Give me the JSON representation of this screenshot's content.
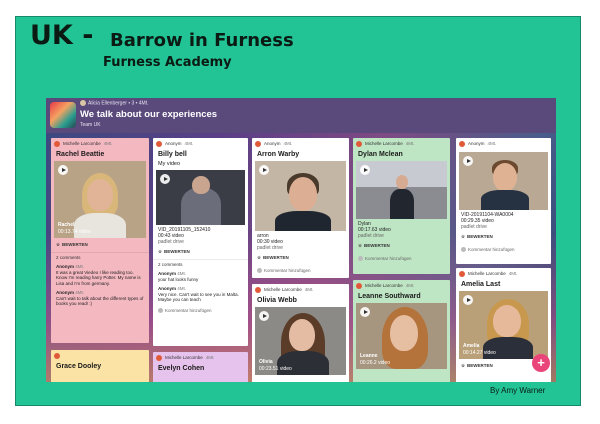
{
  "heading": {
    "country": "UK -",
    "city": "Barrow in Furness",
    "school": "Furness Academy"
  },
  "author": "By Amy Warner",
  "board": {
    "owner": "Alicia Ellenberger",
    "owner_meta": "• 3 • 4Mt.",
    "title": "We talk about our experiences",
    "subtitle": "Team UK"
  },
  "labels": {
    "react": "BEWERTEN",
    "add_comment": "Kommentar hinzufügen",
    "source": "padlet drive"
  },
  "cards": {
    "c1": {
      "author": "Michelle Larcombe",
      "time": "4Mt.",
      "title": "Rachel Beattie",
      "video_name": "Rachel",
      "duration": "00:13.74 video",
      "comments_count": "2 comments",
      "comments": [
        {
          "author": "Anonym",
          "time": "4Mt.",
          "text": "It was a great Viedeo I like reading too. Know I'm reading harry Potter. My name is Lisa and I'm from germany."
        },
        {
          "author": "Anonym",
          "time": "4Mt.",
          "text": "Can't wait to talk about the different types of books you read! :)"
        }
      ]
    },
    "c1b": {
      "title": "Grace Dooley"
    },
    "c2": {
      "author": "Anonym",
      "time": "4Mt.",
      "title": "Billy bell",
      "body": "My video",
      "file": "VID_20191105_152410",
      "duration": "00:43 video",
      "comments_count": "2 comments",
      "comments": [
        {
          "author": "Anonym",
          "time": "4Mt.",
          "text": "your hat looks funny"
        },
        {
          "author": "Anonym",
          "time": "4Mt.",
          "text": "Very nice. Can't wait to see you in Malta. Maybe you can teach"
        }
      ]
    },
    "c2b": {
      "author": "Michelle Larcombe",
      "time": "4Mt.",
      "title": "Evelyn Cohen"
    },
    "c3": {
      "author": "Anonym",
      "time": "4Mt.",
      "title": "Arron Warby",
      "video_name": "arron",
      "duration": "00:30 video"
    },
    "c3b": {
      "author": "Michelle Larcombe",
      "time": "4Mt.",
      "title": "Olivia Webb",
      "video_name": "Olivia",
      "duration": "00:23.51 video"
    },
    "c4": {
      "author": "Michelle Larcombe",
      "time": "4Mt.",
      "title": "Dylan Mclean",
      "video_name": "Dylan",
      "duration": "00:17.63 video"
    },
    "c4b": {
      "author": "Michelle Larcombe",
      "time": "4Mt.",
      "title": "Leanne Southward",
      "video_name": "Leanne",
      "duration": "00:26.2 video"
    },
    "c5": {
      "author": "Anonym",
      "time": "4Mt.",
      "file": "VID-20191104-WA0004",
      "duration": "00:29.35 video"
    },
    "c5b": {
      "author": "Michelle Larcombe",
      "time": "4Mt.",
      "title": "Amelia Last",
      "video_name": "Amelia",
      "duration": "00:14.27 video"
    }
  },
  "fab_label": "+",
  "colors": {
    "slide": "#22c495",
    "pink_card": "#f4b8c1",
    "white_card": "#ffffff",
    "green_card": "#bfe6c4",
    "yellow_card": "#fbe3a6",
    "purple_card": "#e6c3ec",
    "fab": "#e9457a"
  }
}
